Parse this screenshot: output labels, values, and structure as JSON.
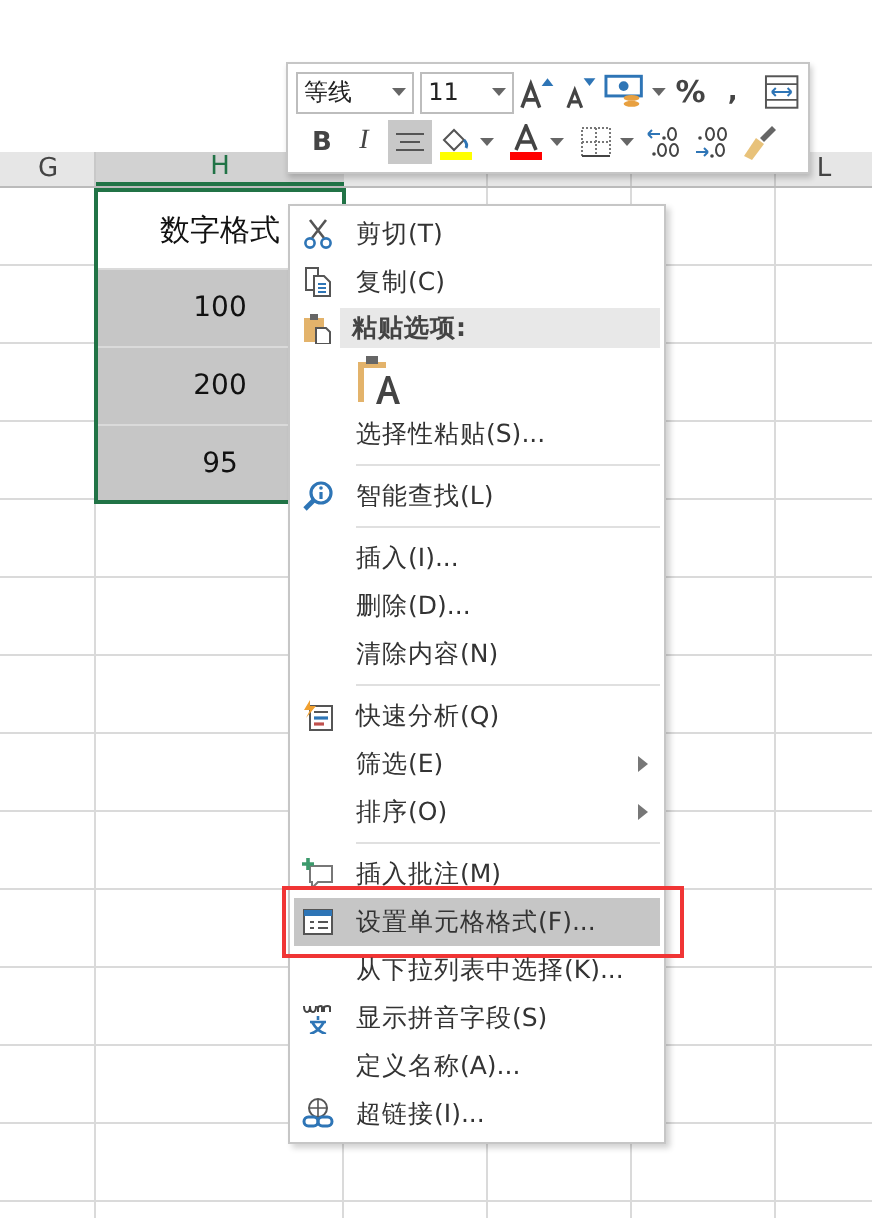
{
  "columns": [
    {
      "label": "G",
      "selected": false
    },
    {
      "label": "H",
      "selected": true
    },
    {
      "label": "L",
      "selected": false
    }
  ],
  "selection_cells": [
    {
      "text": "数字格式",
      "active": true
    },
    {
      "text": "100",
      "active": false
    },
    {
      "text": "200",
      "active": false
    },
    {
      "text": "95",
      "active": false
    }
  ],
  "mini_toolbar": {
    "font_name": "等线",
    "font_size": "11",
    "bold": "B",
    "italic": "I",
    "percent": "%",
    "comma": ",",
    "center_align_selected": true
  },
  "context_menu": [
    {
      "kind": "item",
      "label": "剪切(T)",
      "selected": false
    },
    {
      "kind": "item",
      "label": "复制(C)",
      "selected": false
    },
    {
      "kind": "header",
      "label": "粘贴选项:"
    },
    {
      "kind": "paste_option"
    },
    {
      "kind": "item",
      "label": "选择性粘贴(S)...",
      "selected": false
    },
    {
      "kind": "separator"
    },
    {
      "kind": "item",
      "label": "智能查找(L)",
      "selected": false
    },
    {
      "kind": "separator"
    },
    {
      "kind": "item",
      "label": "插入(I)...",
      "selected": false
    },
    {
      "kind": "item",
      "label": "删除(D)...",
      "selected": false
    },
    {
      "kind": "item",
      "label": "清除内容(N)",
      "selected": false
    },
    {
      "kind": "separator"
    },
    {
      "kind": "item",
      "label": "快速分析(Q)",
      "selected": false
    },
    {
      "kind": "item",
      "label": "筛选(E)",
      "submenu": true,
      "selected": false
    },
    {
      "kind": "item",
      "label": "排序(O)",
      "submenu": true,
      "selected": false
    },
    {
      "kind": "separator"
    },
    {
      "kind": "item",
      "label": "插入批注(M)",
      "selected": false
    },
    {
      "kind": "item",
      "label": "设置单元格格式(F)...",
      "selected": true
    },
    {
      "kind": "item",
      "label": "从下拉列表中选择(K)...",
      "selected": false
    },
    {
      "kind": "item",
      "label": "显示拼音字段(S)",
      "selected": false
    },
    {
      "kind": "item",
      "label": "定义名称(A)...",
      "selected": false
    },
    {
      "kind": "item",
      "label": "超链接(I)...",
      "selected": false
    }
  ]
}
